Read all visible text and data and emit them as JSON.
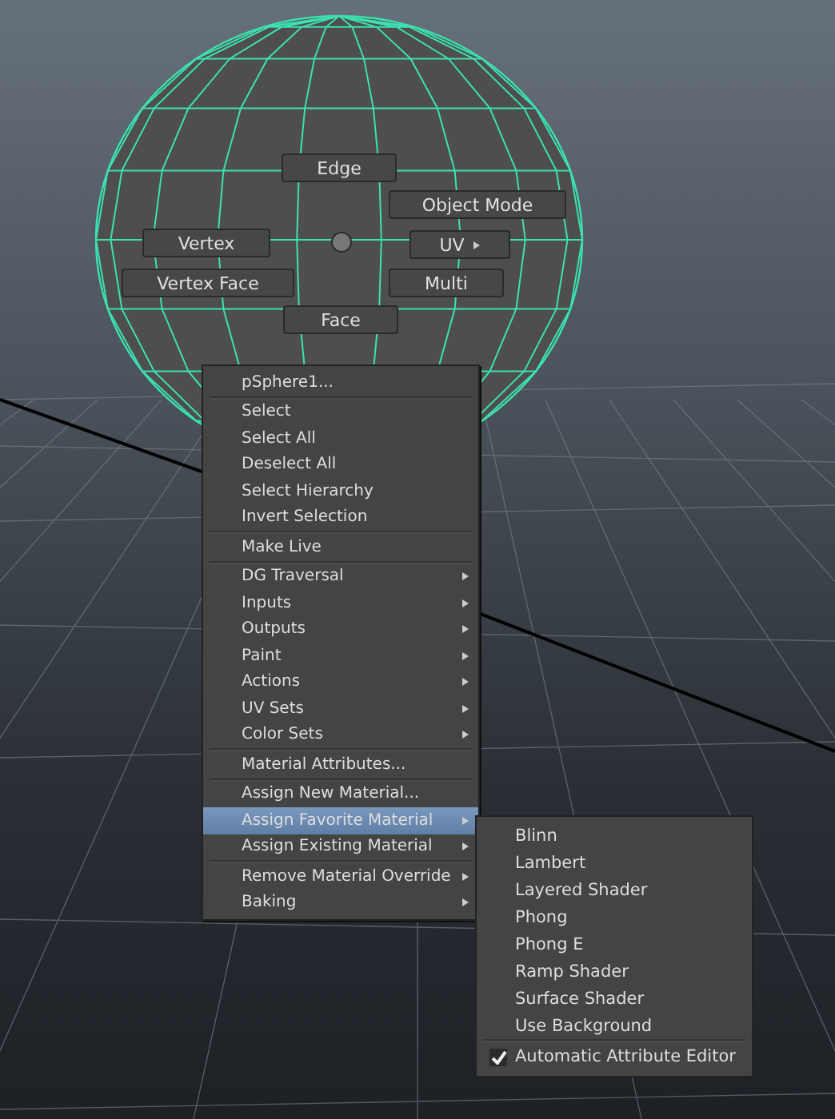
{
  "marking_menu": {
    "items": [
      {
        "label": "Edge",
        "submenu": false
      },
      {
        "label": "Object Mode",
        "submenu": false
      },
      {
        "label": "Vertex",
        "submenu": false
      },
      {
        "label": "UV",
        "submenu": true
      },
      {
        "label": "Vertex Face",
        "submenu": false
      },
      {
        "label": "Multi",
        "submenu": false
      },
      {
        "label": "Face",
        "submenu": false
      }
    ]
  },
  "context_menu": {
    "sections": [
      [
        {
          "label": "pSphere1...",
          "submenu": false,
          "selected": false
        }
      ],
      [
        {
          "label": "Select",
          "submenu": false,
          "selected": false
        },
        {
          "label": "Select All",
          "submenu": false,
          "selected": false
        },
        {
          "label": "Deselect All",
          "submenu": false,
          "selected": false
        },
        {
          "label": "Select Hierarchy",
          "submenu": false,
          "selected": false
        },
        {
          "label": "Invert Selection",
          "submenu": false,
          "selected": false
        }
      ],
      [
        {
          "label": "Make Live",
          "submenu": false,
          "selected": false
        }
      ],
      [
        {
          "label": "DG Traversal",
          "submenu": true,
          "selected": false
        },
        {
          "label": "Inputs",
          "submenu": true,
          "selected": false
        },
        {
          "label": "Outputs",
          "submenu": true,
          "selected": false
        },
        {
          "label": "Paint",
          "submenu": true,
          "selected": false
        },
        {
          "label": "Actions",
          "submenu": true,
          "selected": false
        },
        {
          "label": "UV Sets",
          "submenu": true,
          "selected": false
        },
        {
          "label": "Color Sets",
          "submenu": true,
          "selected": false
        }
      ],
      [
        {
          "label": "Material Attributes...",
          "submenu": false,
          "selected": false
        }
      ],
      [
        {
          "label": "Assign New Material...",
          "submenu": false,
          "selected": false
        },
        {
          "label": "Assign Favorite Material",
          "submenu": true,
          "selected": true
        },
        {
          "label": "Assign Existing Material",
          "submenu": true,
          "selected": false
        }
      ],
      [
        {
          "label": "Remove Material Override",
          "submenu": true,
          "selected": false
        },
        {
          "label": "Baking",
          "submenu": true,
          "selected": false
        }
      ]
    ]
  },
  "submenu": {
    "items": [
      {
        "label": "Blinn"
      },
      {
        "label": "Lambert"
      },
      {
        "label": "Layered Shader"
      },
      {
        "label": "Phong"
      },
      {
        "label": "Phong E"
      },
      {
        "label": "Ramp Shader"
      },
      {
        "label": "Surface Shader"
      },
      {
        "label": "Use Background"
      }
    ],
    "option": {
      "label": "Automatic Attribute Editor",
      "checked": true
    }
  }
}
